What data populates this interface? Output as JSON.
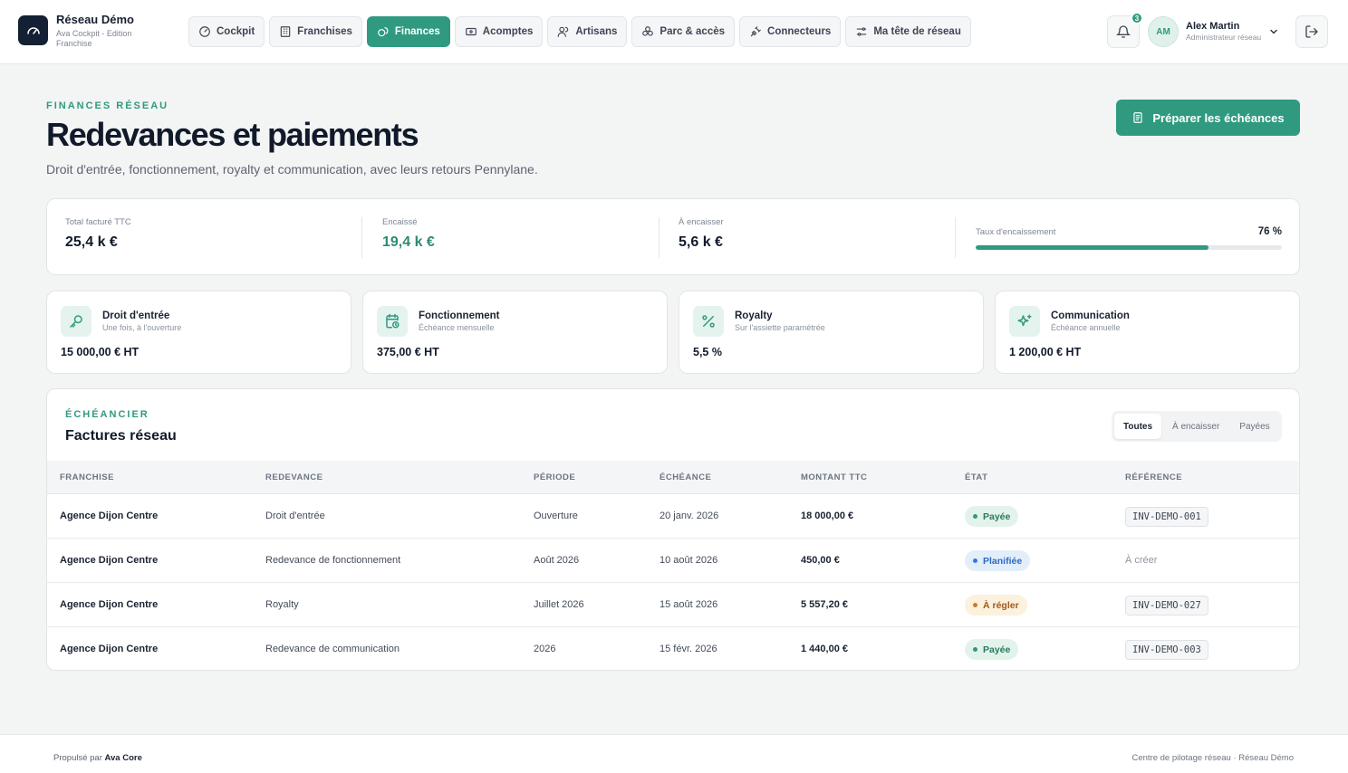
{
  "brand": {
    "title": "Réseau Démo",
    "subtitle": "Ava Cockpit - Edition Franchise"
  },
  "nav": [
    {
      "label": "Cockpit",
      "icon": "gauge-icon"
    },
    {
      "label": "Franchises",
      "icon": "building-icon"
    },
    {
      "label": "Finances",
      "icon": "coins-icon",
      "active": true
    },
    {
      "label": "Acomptes",
      "icon": "banknote-icon"
    },
    {
      "label": "Artisans",
      "icon": "users-icon"
    },
    {
      "label": "Parc & accès",
      "icon": "boxes-icon"
    },
    {
      "label": "Connecteurs",
      "icon": "plug-icon"
    },
    {
      "label": "Ma tête de réseau",
      "icon": "settings-sliders-icon"
    }
  ],
  "notifications": {
    "count": "3"
  },
  "user": {
    "initials": "AM",
    "name": "Alex Martin",
    "role": "Administrateur réseau"
  },
  "header": {
    "eyebrow": "FINANCES RÉSEAU",
    "title": "Redevances et paiements",
    "subtitle": "Droit d'entrée, fonctionnement, royalty et communication, avec leurs retours Pennylane.",
    "action_label": "Préparer les échéances"
  },
  "kpis": {
    "total": {
      "label": "Total facturé TTC",
      "value": "25,4 k €"
    },
    "collected": {
      "label": "Encaissé",
      "value": "19,4 k €"
    },
    "pending": {
      "label": "À encaisser",
      "value": "5,6 k €"
    },
    "rate": {
      "label": "Taux d'encaissement",
      "value": "76 %",
      "fraction": 0.76
    }
  },
  "fees": [
    {
      "title": "Droit d'entrée",
      "subtitle": "Une fois, à l'ouverture",
      "value": "15 000,00 € HT",
      "icon": "key-icon"
    },
    {
      "title": "Fonctionnement",
      "subtitle": "Échéance mensuelle",
      "value": "375,00 € HT",
      "icon": "calendar-clock-icon"
    },
    {
      "title": "Royalty",
      "subtitle": "Sur l'assiette paramétrée",
      "value": "5,5 %",
      "icon": "percent-icon"
    },
    {
      "title": "Communication",
      "subtitle": "Échéance annuelle",
      "value": "1 200,00 € HT",
      "icon": "sparkles-icon"
    }
  ],
  "schedule": {
    "eyebrow": "ÉCHÉANCIER",
    "title": "Factures réseau",
    "filters": [
      {
        "label": "Toutes",
        "active": true
      },
      {
        "label": "À encaisser"
      },
      {
        "label": "Payées"
      }
    ],
    "columns": [
      "FRANCHISE",
      "REDEVANCE",
      "PÉRIODE",
      "ÉCHÉANCE",
      "MONTANT TTC",
      "ÉTAT",
      "RÉFÉRENCE"
    ],
    "rows": [
      {
        "franchise": "Agence Dijon Centre",
        "fee": "Droit d'entrée",
        "period": "Ouverture",
        "due": "20 janv. 2026",
        "amount": "18 000,00 €",
        "status": "Payée",
        "status_kind": "paid",
        "reference": "INV-DEMO-001"
      },
      {
        "franchise": "Agence Dijon Centre",
        "fee": "Redevance de fonctionnement",
        "period": "Août 2026",
        "due": "10 août 2026",
        "amount": "450,00 €",
        "status": "Planifiée",
        "status_kind": "planned",
        "reference_empty": "À créer"
      },
      {
        "franchise": "Agence Dijon Centre",
        "fee": "Royalty",
        "period": "Juillet 2026",
        "due": "15 août 2026",
        "amount": "5 557,20 €",
        "status": "À régler",
        "status_kind": "due",
        "reference": "INV-DEMO-027"
      },
      {
        "franchise": "Agence Dijon Centre",
        "fee": "Redevance de communication",
        "period": "2026",
        "due": "15 févr. 2026",
        "amount": "1 440,00 €",
        "status": "Payée",
        "status_kind": "paid",
        "reference": "INV-DEMO-003"
      }
    ]
  },
  "footer": {
    "powered_prefix": "Propulsé par",
    "powered_brand": "Ava Core",
    "right": "Centre de pilotage réseau · Réseau Démo"
  },
  "colors": {
    "accent": "#2f9a7f",
    "navy": "#142033",
    "paid": "#2f9a7f",
    "planned": "#2f7be0",
    "due": "#d17a24"
  }
}
